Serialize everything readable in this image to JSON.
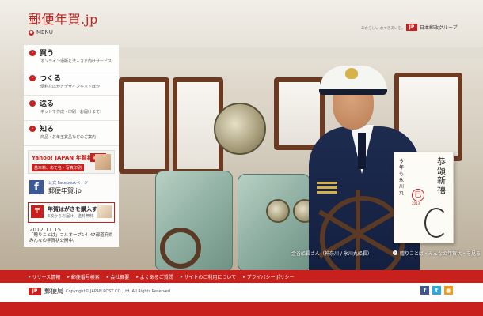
{
  "header": {
    "logo": "郵便年賀.jp",
    "menu_label": "MENU",
    "tagline": "あたらしい おつきあいを。",
    "group_mark": "JP",
    "group_name": "日本郵政グループ"
  },
  "menu": {
    "items": [
      {
        "title": "買う",
        "desc": "オンライン通販と法人さま向けサービス"
      },
      {
        "title": "つくる",
        "desc": "便利なはがきデザインキットほか"
      },
      {
        "title": "送る",
        "desc": "ネットで作成・印刷・お届けまで!"
      },
      {
        "title": "知る",
        "desc": "商品・お年玉賞品などのご案内"
      }
    ],
    "yahoo_banner": {
      "title": "Yahoo! JAPAN 年賀状",
      "badge": "無料!",
      "sub": "基本料、あて名・写真印刷"
    },
    "facebook": {
      "icon": "f",
      "top": "公式 Facebookページ",
      "title": "郵便年賀.jp"
    },
    "buy_banner": {
      "icon": "〒",
      "title": "年賀はがきを購入する",
      "sub": "5枚からお届け、送料無料"
    },
    "news": {
      "date": "2012.11.15",
      "text": "「贈りことば」フルオープン！47都道府県みんなの年賀状公開中。"
    }
  },
  "card": {
    "greeting": "恭頌新禧",
    "zodiac": "巳",
    "year": "2013",
    "side": "今年も氷川丸"
  },
  "captions": {
    "name": "金谷船長さん（神奈川 / 氷川丸船長）",
    "words": "贈りことば・みんなの年賀状・を見る"
  },
  "footer": {
    "links": [
      "リリース情報",
      "郵便番号検索",
      "会社概要",
      "よくあるご質問",
      "サイトのご利用について",
      "プライバシーポリシー"
    ],
    "logo_mark": "JP",
    "logo_text": "郵便局",
    "copyright": "Copyright© JAPAN POST CO.,Ltd. All Rights Reserved."
  },
  "social": [
    {
      "icon": "facebook-icon",
      "glyph": "f",
      "color": "#3b5998"
    },
    {
      "icon": "twitter-icon",
      "glyph": "t",
      "color": "#2ea7e0"
    },
    {
      "icon": "rss-icon",
      "glyph": "◉",
      "color": "#f39a19"
    }
  ],
  "colors": {
    "brand_red": "#c7201d",
    "navy": "#142040"
  }
}
